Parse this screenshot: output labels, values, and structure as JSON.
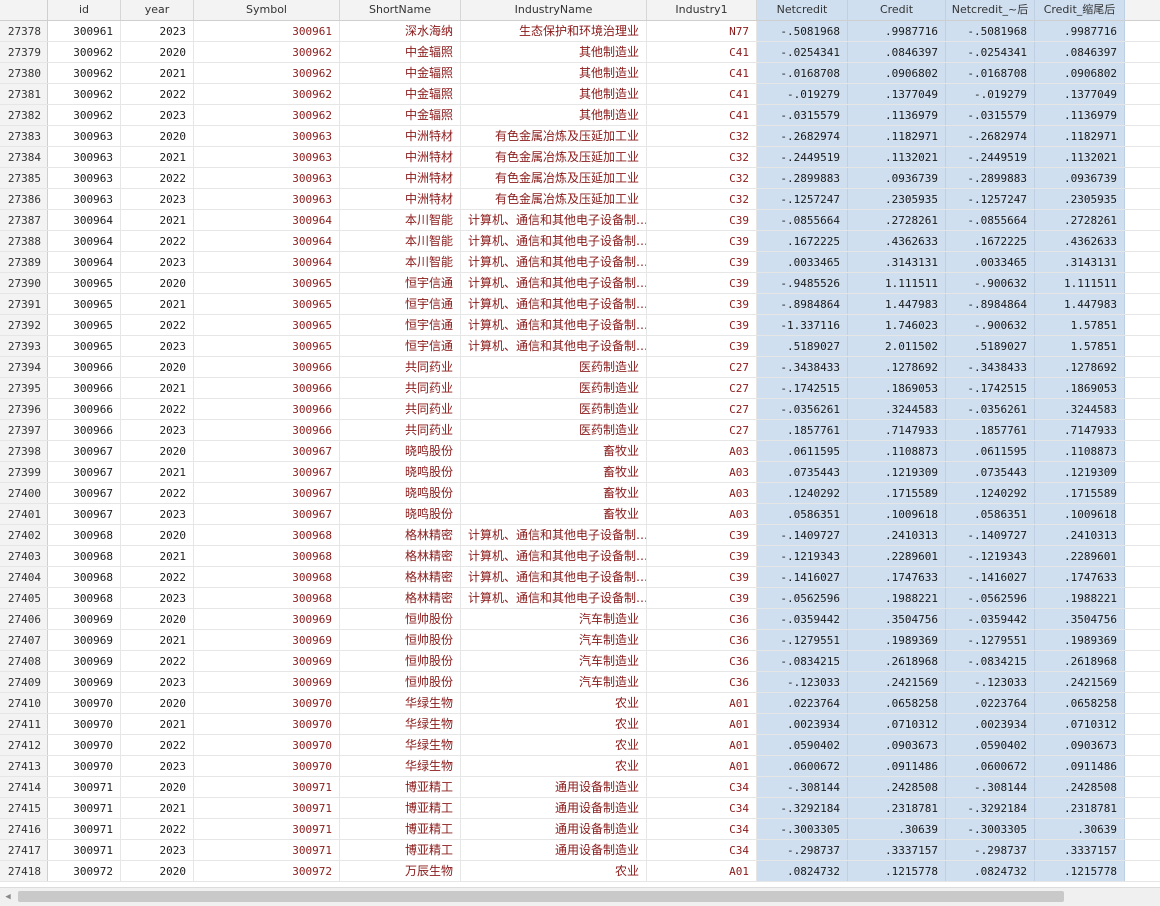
{
  "columns": [
    "",
    "id",
    "year",
    "Symbol",
    "ShortName",
    "IndustryName",
    "Industry1",
    "Netcredit",
    "Credit",
    "Netcredit_~后",
    "Credit_缩尾后"
  ],
  "rows": [
    [
      "27378",
      "300961",
      "2023",
      "300961",
      "深水海纳",
      "生态保护和环境治理业",
      "N77",
      "-.5081968",
      ".9987716",
      "-.5081968",
      ".9987716"
    ],
    [
      "27379",
      "300962",
      "2020",
      "300962",
      "中金辐照",
      "其他制造业",
      "C41",
      "-.0254341",
      ".0846397",
      "-.0254341",
      ".0846397"
    ],
    [
      "27380",
      "300962",
      "2021",
      "300962",
      "中金辐照",
      "其他制造业",
      "C41",
      "-.0168708",
      ".0906802",
      "-.0168708",
      ".0906802"
    ],
    [
      "27381",
      "300962",
      "2022",
      "300962",
      "中金辐照",
      "其他制造业",
      "C41",
      "-.019279",
      ".1377049",
      "-.019279",
      ".1377049"
    ],
    [
      "27382",
      "300962",
      "2023",
      "300962",
      "中金辐照",
      "其他制造业",
      "C41",
      "-.0315579",
      ".1136979",
      "-.0315579",
      ".1136979"
    ],
    [
      "27383",
      "300963",
      "2020",
      "300963",
      "中洲特材",
      "有色金属冶炼及压延加工业",
      "C32",
      "-.2682974",
      ".1182971",
      "-.2682974",
      ".1182971"
    ],
    [
      "27384",
      "300963",
      "2021",
      "300963",
      "中洲特材",
      "有色金属冶炼及压延加工业",
      "C32",
      "-.2449519",
      ".1132021",
      "-.2449519",
      ".1132021"
    ],
    [
      "27385",
      "300963",
      "2022",
      "300963",
      "中洲特材",
      "有色金属冶炼及压延加工业",
      "C32",
      "-.2899883",
      ".0936739",
      "-.2899883",
      ".0936739"
    ],
    [
      "27386",
      "300963",
      "2023",
      "300963",
      "中洲特材",
      "有色金属冶炼及压延加工业",
      "C32",
      "-.1257247",
      ".2305935",
      "-.1257247",
      ".2305935"
    ],
    [
      "27387",
      "300964",
      "2021",
      "300964",
      "本川智能",
      "计算机、通信和其他电子设备制…",
      "C39",
      "-.0855664",
      ".2728261",
      "-.0855664",
      ".2728261"
    ],
    [
      "27388",
      "300964",
      "2022",
      "300964",
      "本川智能",
      "计算机、通信和其他电子设备制…",
      "C39",
      ".1672225",
      ".4362633",
      ".1672225",
      ".4362633"
    ],
    [
      "27389",
      "300964",
      "2023",
      "300964",
      "本川智能",
      "计算机、通信和其他电子设备制…",
      "C39",
      ".0033465",
      ".3143131",
      ".0033465",
      ".3143131"
    ],
    [
      "27390",
      "300965",
      "2020",
      "300965",
      "恒宇信通",
      "计算机、通信和其他电子设备制…",
      "C39",
      "-.9485526",
      "1.111511",
      "-.900632",
      "1.111511"
    ],
    [
      "27391",
      "300965",
      "2021",
      "300965",
      "恒宇信通",
      "计算机、通信和其他电子设备制…",
      "C39",
      "-.8984864",
      "1.447983",
      "-.8984864",
      "1.447983"
    ],
    [
      "27392",
      "300965",
      "2022",
      "300965",
      "恒宇信通",
      "计算机、通信和其他电子设备制…",
      "C39",
      "-1.337116",
      "1.746023",
      "-.900632",
      "1.57851"
    ],
    [
      "27393",
      "300965",
      "2023",
      "300965",
      "恒宇信通",
      "计算机、通信和其他电子设备制…",
      "C39",
      ".5189027",
      "2.011502",
      ".5189027",
      "1.57851"
    ],
    [
      "27394",
      "300966",
      "2020",
      "300966",
      "共同药业",
      "医药制造业",
      "C27",
      "-.3438433",
      ".1278692",
      "-.3438433",
      ".1278692"
    ],
    [
      "27395",
      "300966",
      "2021",
      "300966",
      "共同药业",
      "医药制造业",
      "C27",
      "-.1742515",
      ".1869053",
      "-.1742515",
      ".1869053"
    ],
    [
      "27396",
      "300966",
      "2022",
      "300966",
      "共同药业",
      "医药制造业",
      "C27",
      "-.0356261",
      ".3244583",
      "-.0356261",
      ".3244583"
    ],
    [
      "27397",
      "300966",
      "2023",
      "300966",
      "共同药业",
      "医药制造业",
      "C27",
      ".1857761",
      ".7147933",
      ".1857761",
      ".7147933"
    ],
    [
      "27398",
      "300967",
      "2020",
      "300967",
      "晓鸣股份",
      "畜牧业",
      "A03",
      ".0611595",
      ".1108873",
      ".0611595",
      ".1108873"
    ],
    [
      "27399",
      "300967",
      "2021",
      "300967",
      "晓鸣股份",
      "畜牧业",
      "A03",
      ".0735443",
      ".1219309",
      ".0735443",
      ".1219309"
    ],
    [
      "27400",
      "300967",
      "2022",
      "300967",
      "晓鸣股份",
      "畜牧业",
      "A03",
      ".1240292",
      ".1715589",
      ".1240292",
      ".1715589"
    ],
    [
      "27401",
      "300967",
      "2023",
      "300967",
      "晓鸣股份",
      "畜牧业",
      "A03",
      ".0586351",
      ".1009618",
      ".0586351",
      ".1009618"
    ],
    [
      "27402",
      "300968",
      "2020",
      "300968",
      "格林精密",
      "计算机、通信和其他电子设备制…",
      "C39",
      "-.1409727",
      ".2410313",
      "-.1409727",
      ".2410313"
    ],
    [
      "27403",
      "300968",
      "2021",
      "300968",
      "格林精密",
      "计算机、通信和其他电子设备制…",
      "C39",
      "-.1219343",
      ".2289601",
      "-.1219343",
      ".2289601"
    ],
    [
      "27404",
      "300968",
      "2022",
      "300968",
      "格林精密",
      "计算机、通信和其他电子设备制…",
      "C39",
      "-.1416027",
      ".1747633",
      "-.1416027",
      ".1747633"
    ],
    [
      "27405",
      "300968",
      "2023",
      "300968",
      "格林精密",
      "计算机、通信和其他电子设备制…",
      "C39",
      "-.0562596",
      ".1988221",
      "-.0562596",
      ".1988221"
    ],
    [
      "27406",
      "300969",
      "2020",
      "300969",
      "恒帅股份",
      "汽车制造业",
      "C36",
      "-.0359442",
      ".3504756",
      "-.0359442",
      ".3504756"
    ],
    [
      "27407",
      "300969",
      "2021",
      "300969",
      "恒帅股份",
      "汽车制造业",
      "C36",
      "-.1279551",
      ".1989369",
      "-.1279551",
      ".1989369"
    ],
    [
      "27408",
      "300969",
      "2022",
      "300969",
      "恒帅股份",
      "汽车制造业",
      "C36",
      "-.0834215",
      ".2618968",
      "-.0834215",
      ".2618968"
    ],
    [
      "27409",
      "300969",
      "2023",
      "300969",
      "恒帅股份",
      "汽车制造业",
      "C36",
      "-.123033",
      ".2421569",
      "-.123033",
      ".2421569"
    ],
    [
      "27410",
      "300970",
      "2020",
      "300970",
      "华绿生物",
      "农业",
      "A01",
      ".0223764",
      ".0658258",
      ".0223764",
      ".0658258"
    ],
    [
      "27411",
      "300970",
      "2021",
      "300970",
      "华绿生物",
      "农业",
      "A01",
      ".0023934",
      ".0710312",
      ".0023934",
      ".0710312"
    ],
    [
      "27412",
      "300970",
      "2022",
      "300970",
      "华绿生物",
      "农业",
      "A01",
      ".0590402",
      ".0903673",
      ".0590402",
      ".0903673"
    ],
    [
      "27413",
      "300970",
      "2023",
      "300970",
      "华绿生物",
      "农业",
      "A01",
      ".0600672",
      ".0911486",
      ".0600672",
      ".0911486"
    ],
    [
      "27414",
      "300971",
      "2020",
      "300971",
      "博亚精工",
      "通用设备制造业",
      "C34",
      "-.308144",
      ".2428508",
      "-.308144",
      ".2428508"
    ],
    [
      "27415",
      "300971",
      "2021",
      "300971",
      "博亚精工",
      "通用设备制造业",
      "C34",
      "-.3292184",
      ".2318781",
      "-.3292184",
      ".2318781"
    ],
    [
      "27416",
      "300971",
      "2022",
      "300971",
      "博亚精工",
      "通用设备制造业",
      "C34",
      "-.3003305",
      ".30639",
      "-.3003305",
      ".30639"
    ],
    [
      "27417",
      "300971",
      "2023",
      "300971",
      "博亚精工",
      "通用设备制造业",
      "C34",
      "-.298737",
      ".3337157",
      "-.298737",
      ".3337157"
    ],
    [
      "27418",
      "300972",
      "2020",
      "300972",
      "万辰生物",
      "农业",
      "A01",
      ".0824732",
      ".1215778",
      ".0824732",
      ".1215778"
    ]
  ]
}
